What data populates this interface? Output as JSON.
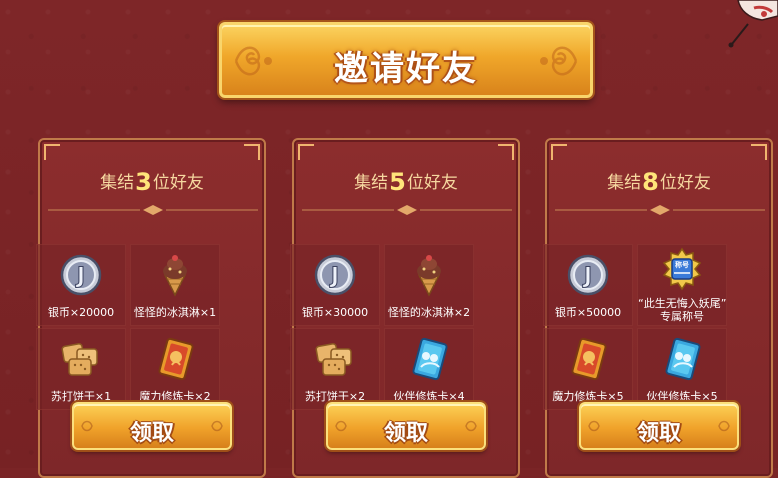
{
  "header": {
    "title": "邀请好友"
  },
  "colors": {
    "background": "#7a2426",
    "gold": "#f0a72a",
    "title_number": "#ffe57a"
  },
  "panels": [
    {
      "title_prefix": "集结",
      "count": "3",
      "title_suffix": "位好友",
      "rewards": [
        {
          "icon": "silver-coin-icon",
          "label": "银币×20000"
        },
        {
          "icon": "ice-cream-icon",
          "label": "怪怪的冰淇淋×1"
        },
        {
          "icon": "soda-cracker-icon",
          "label": "苏打饼干×1"
        },
        {
          "icon": "magic-training-card-icon",
          "label": "魔力修炼卡×2"
        }
      ],
      "button_label": "领取"
    },
    {
      "title_prefix": "集结",
      "count": "5",
      "title_suffix": "位好友",
      "rewards": [
        {
          "icon": "silver-coin-icon",
          "label": "银币×30000"
        },
        {
          "icon": "ice-cream-icon",
          "label": "怪怪的冰淇淋×2"
        },
        {
          "icon": "soda-cracker-icon",
          "label": "苏打饼干×2"
        },
        {
          "icon": "partner-training-card-icon",
          "label": "伙伴修炼卡×4"
        }
      ],
      "button_label": "领取"
    },
    {
      "title_prefix": "集结",
      "count": "8",
      "title_suffix": "位好友",
      "rewards": [
        {
          "icon": "silver-coin-icon",
          "label": "银币×50000"
        },
        {
          "icon": "title-badge-icon",
          "label_line1": "“此生无悔入妖尾”",
          "label_line2": "专属称号",
          "badge_text": "称号"
        },
        {
          "icon": "magic-training-card-icon",
          "label": "魔力修炼卡×5"
        },
        {
          "icon": "partner-training-card-icon",
          "label": "伙伴修炼卡×5"
        }
      ],
      "button_label": "领取"
    }
  ]
}
